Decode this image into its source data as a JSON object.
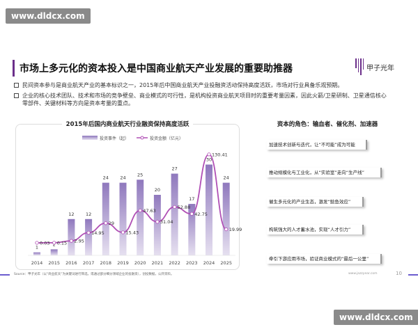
{
  "watermark": "www.dldcx.com",
  "title": "市场上多元化的资本投入是中国商业航天产业发展的重要助推器",
  "logo": "甲子光年",
  "bullets": [
    "民间资本参与是商业航天产业的基本标识之一，2015年后中国商业航天产业投融资活动保持高度活跃，市场对行业具备乐观预期。",
    "企业的核心技术团队、技术和市场的竞争壁垒、商业模式的可行性，是机构投资商业航天项目时的重要考量因素，因此火箭/卫星研制、卫星通信核心零部件、关键材料等方向是资本考量的重点。"
  ],
  "chart_data": {
    "type": "bar",
    "title": "2015年后国内商业航天行业融资保持高度活跃",
    "categories": [
      "2014",
      "2015",
      "2016",
      "2017",
      "2018",
      "2019",
      "2020",
      "2021",
      "2022",
      "2023",
      "2024",
      "2025"
    ],
    "series": [
      {
        "name": "投资事件（起）",
        "type": "bar",
        "values": [
          1,
          2,
          12,
          12,
          24,
          24,
          25,
          20,
          27,
          17,
          30,
          24
        ],
        "color": "#9b86c4"
      },
      {
        "name": "投资金额（亿元）",
        "type": "line",
        "values": [
          0.03,
          0.15,
          2.95,
          14.95,
          29,
          15.43,
          47.63,
          31.04,
          52.88,
          42.75,
          130.41,
          19.99
        ],
        "color": "#b04fb5"
      }
    ],
    "legend": "top",
    "grid": false
  },
  "right": {
    "title": "资本的角色：输血者、催化剂、加速器",
    "cards": [
      "加速技术创新与迭代，让“不可能”成为可能",
      "推动规模化与工业化，从“实验室”走向“生产线”",
      "催生多元化的产业生态，激发“鲶鱼效应”",
      "构筑强大的人才蓄水池，实现“人才引力”",
      "牵引下游应用市场，验证商业模式的“最后一公里”"
    ]
  },
  "footer": {
    "source": "Source：甲子光年（以“商业航天”为关键词进行筛选，或通过部分细分领域企业的投融资），创投数据，公开资料。",
    "site": "www.jazzyear.com",
    "page": "10"
  }
}
